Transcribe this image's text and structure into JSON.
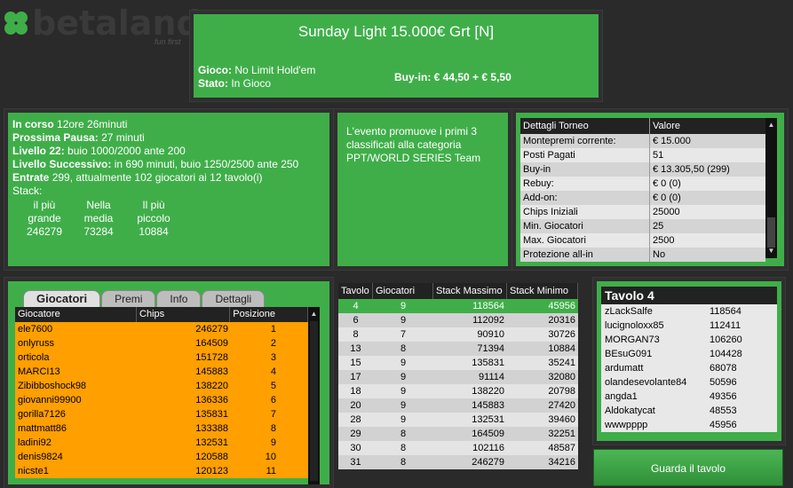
{
  "logo": {
    "brand": "betaland",
    "tagline": "fun first"
  },
  "header": {
    "title": "Sunday Light 15.000€ Grt   [N]",
    "gioco_label": "Gioco:",
    "gioco_value": "No Limit Hold'em",
    "stato_label": "Stato:",
    "stato_value": "In Gioco",
    "buyin_label": "Buy-in:",
    "buyin_value": "€ 44,50 + € 5,50"
  },
  "info": {
    "in_corso_label": "In corso",
    "in_corso_value": "12ore 26minuti",
    "pausa_label": "Prossima Pausa:",
    "pausa_value": "27 minuti",
    "livello_label": "Livello 22:",
    "livello_value": "buio 1000/2000 ante 200",
    "successivo_label": "Livello Successivo:",
    "successivo_value": "in 690 minuti, buio 1250/2500 ante 250",
    "entrate_label": "Entrate",
    "entrate_value": "299, attualmente 102 giocatori ai 12 tavolo(i)",
    "stack_label": "Stack:",
    "stack_cols": [
      {
        "l1": "il più",
        "l2": "grande",
        "value": "246279"
      },
      {
        "l1": "Nella",
        "l2": "media",
        "value": "73284"
      },
      {
        "l1": "Il più",
        "l2": "piccolo",
        "value": "10884"
      }
    ]
  },
  "promo": {
    "text": "L'evento promuove i primi 3 classificati alla categoria PPT/WORLD SERIES Team"
  },
  "details": {
    "headers": [
      "Dettagli Torneo",
      "Valore"
    ],
    "rows": [
      [
        "Montepremi corrente:",
        "€ 15.000"
      ],
      [
        "Posti Pagati",
        "51"
      ],
      [
        "Buy-in",
        "€ 13.305,50 (299)"
      ],
      [
        "Rebuy:",
        "€ 0 (0)"
      ],
      [
        "Add-on:",
        "€ 0 (0)"
      ],
      [
        "Chips Iniziali",
        "25000"
      ],
      [
        "Min. Giocatori",
        "25"
      ],
      [
        "Max. Giocatori",
        "2500"
      ],
      [
        "Protezione all-in",
        "No"
      ]
    ]
  },
  "players": {
    "tabs": [
      "Giocatori",
      "Premi",
      "Info",
      "Dettagli"
    ],
    "headers": [
      "Giocatore",
      "Chips",
      "Posizione"
    ],
    "rows": [
      [
        "ele7600",
        "246279",
        "1"
      ],
      [
        "onlyruss",
        "164509",
        "2"
      ],
      [
        "orticola",
        "151728",
        "3"
      ],
      [
        "MARCI13",
        "145883",
        "4"
      ],
      [
        "Zibibboshock98",
        "138220",
        "5"
      ],
      [
        "giovanni99900",
        "136336",
        "6"
      ],
      [
        "gorilla7126",
        "135831",
        "7"
      ],
      [
        "mattmatt86",
        "133388",
        "8"
      ],
      [
        "ladini92",
        "132531",
        "9"
      ],
      [
        "denis9824",
        "120588",
        "10"
      ],
      [
        "nicste1",
        "120123",
        "11"
      ]
    ]
  },
  "tables": {
    "headers": [
      "Tavolo",
      "Giocatori",
      "Stack Massimo",
      "Stack Minimo"
    ],
    "rows": [
      [
        "4",
        "9",
        "118564",
        "45956"
      ],
      [
        "6",
        "9",
        "112092",
        "20316"
      ],
      [
        "8",
        "7",
        "90910",
        "30726"
      ],
      [
        "13",
        "8",
        "71394",
        "10884"
      ],
      [
        "15",
        "9",
        "135831",
        "35241"
      ],
      [
        "17",
        "9",
        "91114",
        "32080"
      ],
      [
        "18",
        "9",
        "138220",
        "20798"
      ],
      [
        "20",
        "9",
        "145883",
        "27420"
      ],
      [
        "28",
        "9",
        "132531",
        "39460"
      ],
      [
        "29",
        "8",
        "164509",
        "32251"
      ],
      [
        "30",
        "8",
        "102116",
        "48587"
      ],
      [
        "31",
        "8",
        "246279",
        "34216"
      ]
    ]
  },
  "tavolo": {
    "title": "Tavolo 4",
    "rows": [
      [
        "zLackSalfe",
        "118564"
      ],
      [
        "lucignoloxx85",
        "112411"
      ],
      [
        "MORGAN73",
        "106260"
      ],
      [
        "BEsuG091",
        "104428"
      ],
      [
        "ardumatt",
        "68078"
      ],
      [
        "olandesevolante84",
        "50596"
      ],
      [
        "angda1",
        "49356"
      ],
      [
        "Aldokatycat",
        "48553"
      ],
      [
        "wwwpppp",
        "45956"
      ]
    ]
  },
  "watch_button": "Guarda il tavolo",
  "colors": {
    "panel_green": "#3fae49",
    "player_orange": "#ff9f00",
    "background": "#2a2a2a"
  }
}
